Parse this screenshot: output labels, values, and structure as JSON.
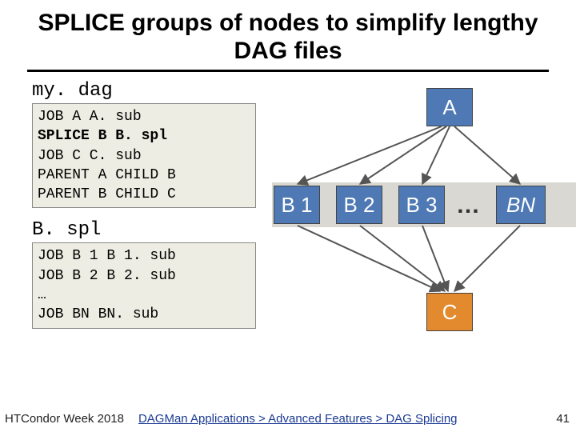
{
  "title": "SPLICE groups of nodes to simplify lengthy DAG files",
  "files": {
    "mydag": {
      "label": "my. dag",
      "lines": [
        "JOB A A. sub",
        "SPLICE B B. spl",
        "JOB C C. sub",
        "PARENT A CHILD B",
        "PARENT B CHILD C"
      ],
      "bold_line_index": 1
    },
    "bspl": {
      "label": "B. spl",
      "lines": [
        "JOB B 1 B 1. sub",
        "JOB B 2 B 2. sub",
        "…",
        "JOB BN BN. sub"
      ]
    }
  },
  "diagram": {
    "A": "A",
    "B1": "B 1",
    "B2": "B 2",
    "B3": "B 3",
    "dots": "…",
    "BN": "BN",
    "C": "C"
  },
  "footer": {
    "source": "HTCondor Week 2018",
    "crumb": "DAGMan Applications > Advanced Features > DAG Splicing",
    "page": "41"
  }
}
